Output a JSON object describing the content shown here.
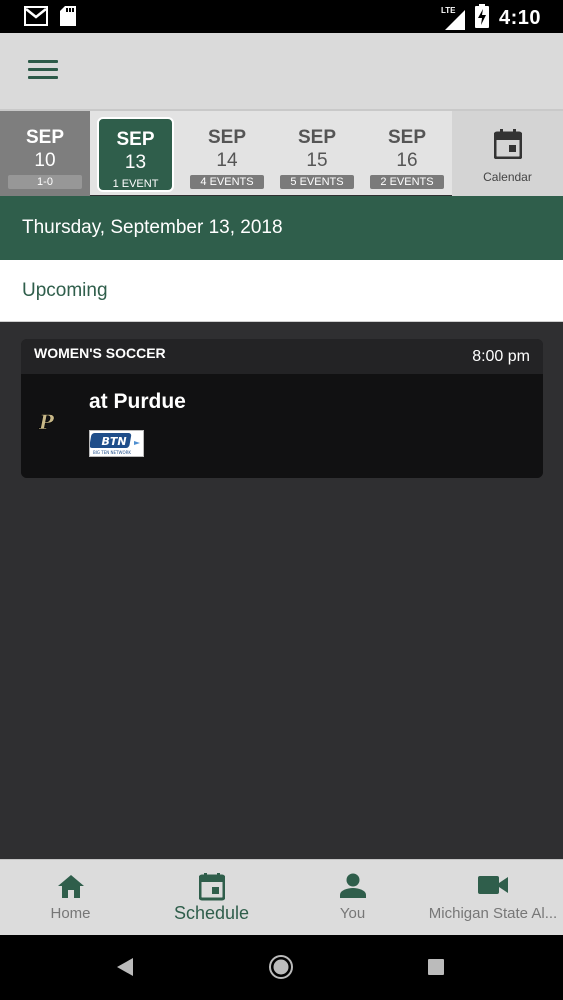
{
  "status_bar": {
    "time": "4:10",
    "network": "LTE"
  },
  "date_strip": {
    "days": [
      {
        "month": "SEP",
        "day": "10",
        "badge": "1-0"
      },
      {
        "month": "SEP",
        "day": "13",
        "badge": "1 EVENT"
      },
      {
        "month": "SEP",
        "day": "14",
        "badge": "4 EVENTS"
      },
      {
        "month": "SEP",
        "day": "15",
        "badge": "5 EVENTS"
      },
      {
        "month": "SEP",
        "day": "16",
        "badge": "2 EVENTS"
      }
    ],
    "calendar_label": "Calendar"
  },
  "date_header": "Thursday, September 13, 2018",
  "section_label": "Upcoming",
  "event": {
    "sport": "WOMEN'S SOCCER",
    "time": "8:00 pm",
    "opponent": "at Purdue",
    "opponent_logo_text": "P",
    "tv_network": "BTN",
    "tv_network_sub": "BIG TEN NETWORK"
  },
  "bottom_nav": {
    "home": "Home",
    "schedule": "Schedule",
    "you": "You",
    "video": "Michigan State Al..."
  },
  "colors": {
    "brand_green": "#2f5e4b",
    "background": "#2f2f31"
  }
}
